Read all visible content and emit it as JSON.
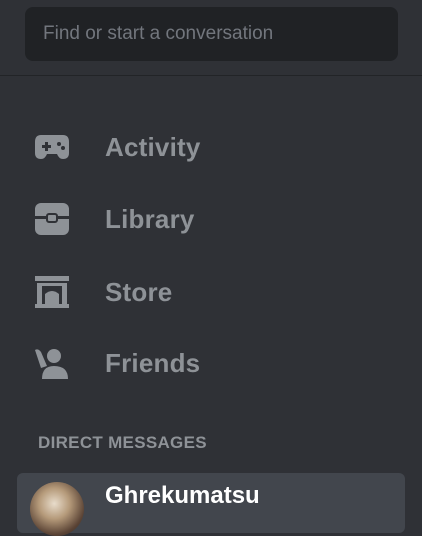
{
  "search": {
    "placeholder": "Find or start a conversation"
  },
  "nav": {
    "items": [
      {
        "label": "Activity",
        "icon": "gamepad-icon"
      },
      {
        "label": "Library",
        "icon": "library-icon"
      },
      {
        "label": "Store",
        "icon": "store-icon"
      },
      {
        "label": "Friends",
        "icon": "friends-icon"
      }
    ]
  },
  "direct_messages": {
    "header": "DIRECT MESSAGES",
    "items": [
      {
        "name": "Ghrekumatsu"
      }
    ]
  },
  "colors": {
    "background": "#2f3136",
    "search_bg": "#202225",
    "muted_text": "#8e9297",
    "selected_bg": "#42464d"
  }
}
